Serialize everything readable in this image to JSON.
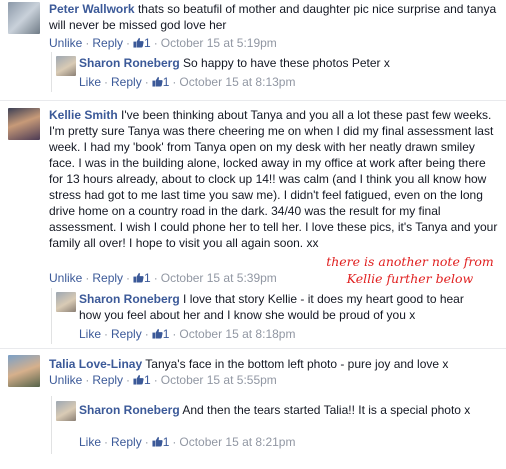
{
  "thread": [
    {
      "author": "Peter Wallwork",
      "text": "thats so beatufil of mother and daughter pic nice surprise and tanya will never be missed god love her",
      "actions": {
        "unlike": "Unlike",
        "reply": "Reply",
        "likes": "1",
        "time": "October 15 at 5:19pm"
      },
      "reply": {
        "author": "Sharon Roneberg",
        "text": "So happy to have these photos Peter x",
        "actions": {
          "like": "Like",
          "reply": "Reply",
          "likes": "1",
          "time": "October 15 at 8:13pm"
        }
      }
    },
    {
      "author": "Kellie Smith",
      "text": "I've been thinking about Tanya and you all a lot these past few weeks. I'm pretty sure Tanya was there cheering me on when I did my final assessment last week. I had my 'book' from Tanya open on my desk with her neatly drawn smiley face. I was in the building alone, locked away in my office at work after being there for 13 hours already, about to clock up 14!! was calm (and I think you all know how stress had got to me last time you saw me). I didn't feel fatigued, even on the long drive home on a country road in the dark. 34/40 was the result for my final assessment. I wish I could phone her to tell her. I love these pics, it's Tanya and your family all over! I hope to visit you all again soon. xx",
      "actions": {
        "unlike": "Unlike",
        "reply": "Reply",
        "likes": "1",
        "time": "October 15 at 5:39pm"
      },
      "annotation": [
        "there is another note from",
        "Kellie further below"
      ],
      "reply": {
        "author": "Sharon Roneberg",
        "text": "I love that story Kellie - it does my heart good to hear how you feel about her and I know she would be proud of you x",
        "actions": {
          "like": "Like",
          "reply": "Reply",
          "likes": "1",
          "time": "October 15 at 8:18pm"
        }
      }
    },
    {
      "author": "Talia Love-Linay",
      "text": "Tanya's face in the bottom left photo - pure joy and love x",
      "actions": {
        "unlike": "Unlike",
        "reply": "Reply",
        "likes": "1",
        "time": "October 15 at 5:55pm"
      },
      "reply": {
        "author": "Sharon Roneberg",
        "text": "And then the tears started Talia!! It is a special photo x",
        "actions": {
          "like": "Like",
          "reply": "Reply",
          "likes": "1",
          "time": "October 15 at 8:21pm"
        }
      }
    }
  ],
  "colors": {
    "link": "#3b5998",
    "meta": "#9197a3",
    "annotation": "#e02020"
  },
  "icons": {
    "like_count": "thumbs-up-icon"
  }
}
